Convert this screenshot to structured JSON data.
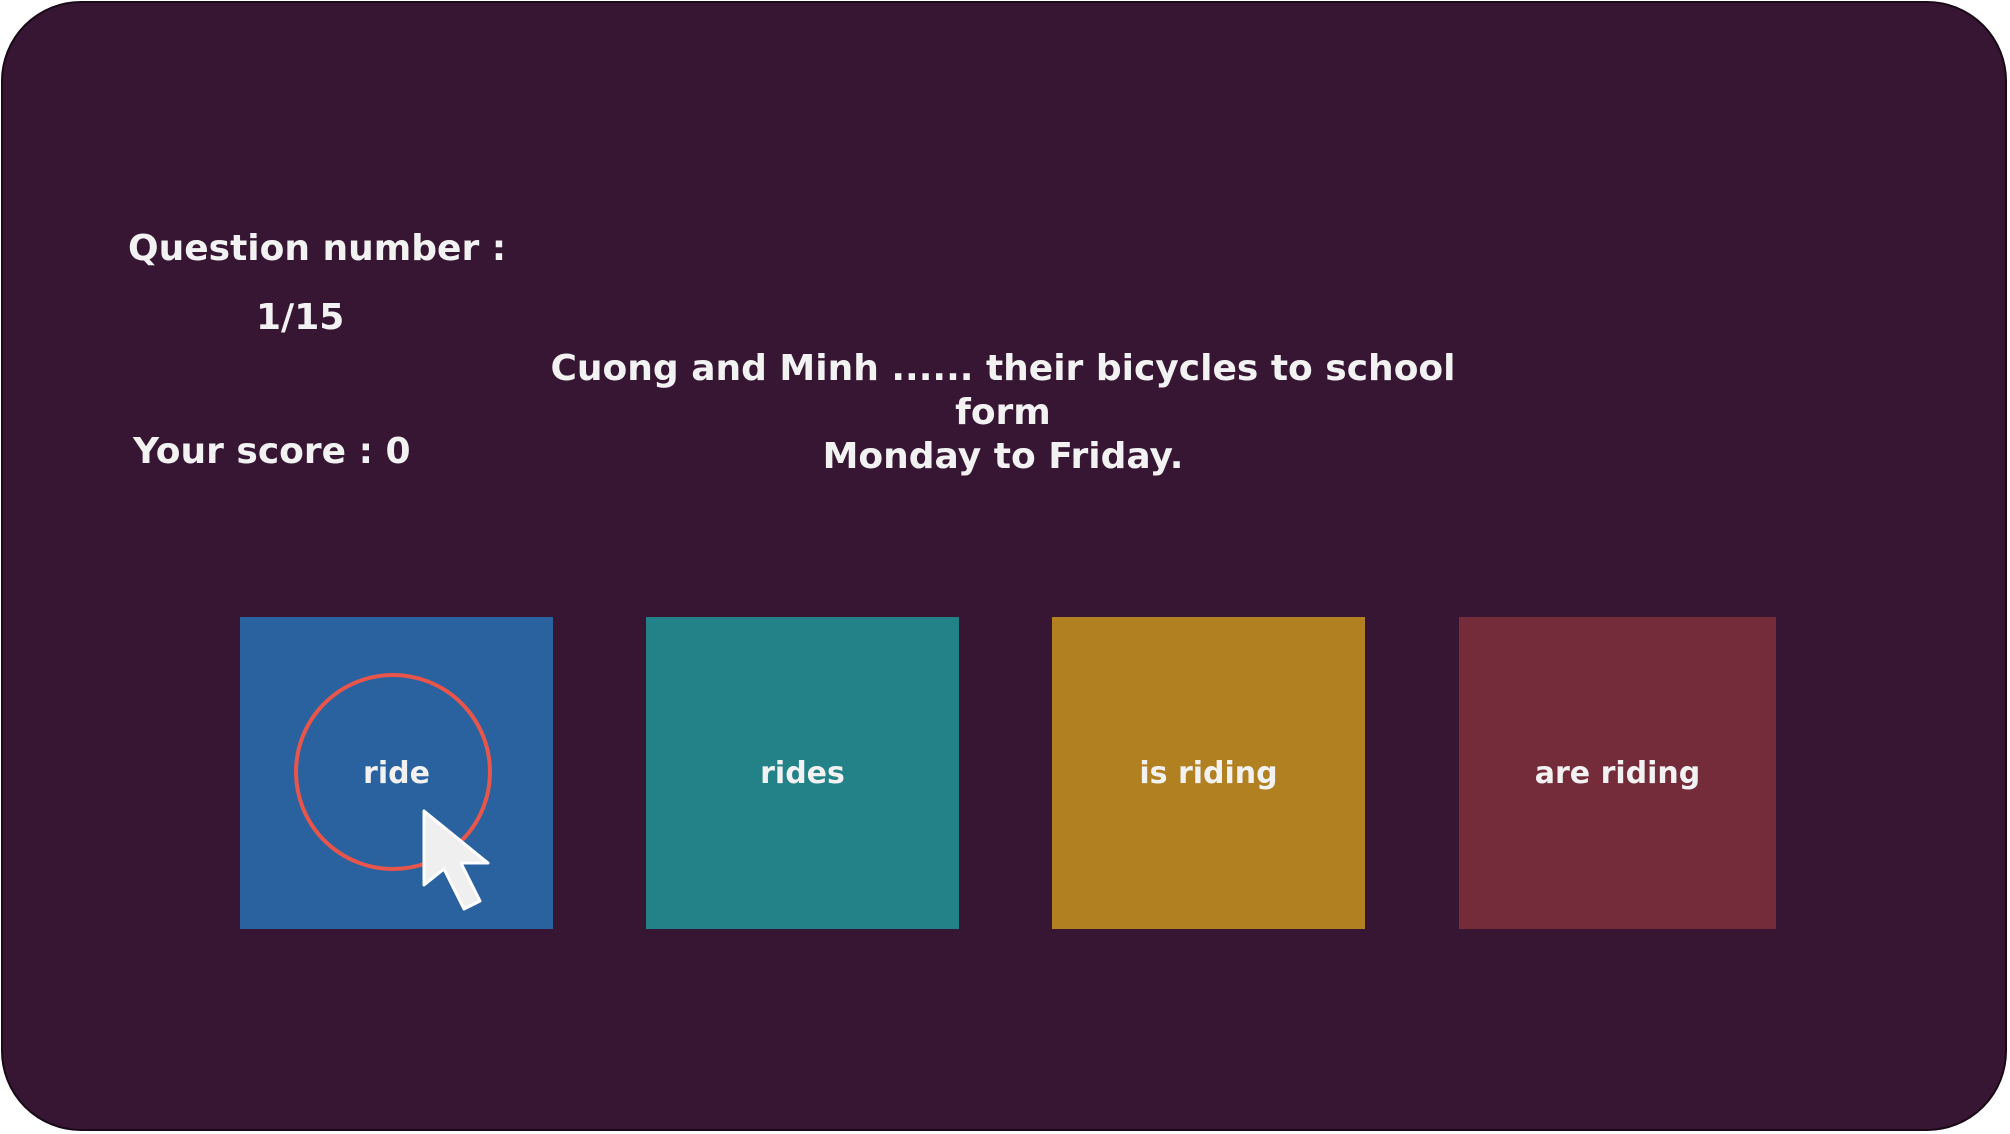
{
  "quiz": {
    "question_number_label": "Question number :",
    "question_number_value": "1/15",
    "score_label": "Your score : 0",
    "question_line1": "Cuong and Minh ...... their bicycles to school form",
    "question_line2": "Monday to Friday.",
    "answers": [
      {
        "label": "ride",
        "color": "#2a62a0"
      },
      {
        "label": "rides",
        "color": "#238188"
      },
      {
        "label": "is riding",
        "color": "#b08021"
      },
      {
        "label": "are riding",
        "color": "#742c3a"
      }
    ]
  },
  "colors": {
    "background": "#371633",
    "highlight_ring": "#e8554a",
    "text": "#f2f2f2"
  },
  "icons": {
    "pointer": "mouse-pointer-icon"
  }
}
